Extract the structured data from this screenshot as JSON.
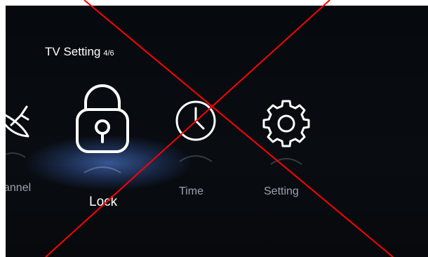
{
  "header": {
    "title": "TV Setting",
    "page_indicator": "4/6"
  },
  "menu": {
    "items": [
      {
        "label": "Channel",
        "visible_label": "annel",
        "icon": "satellite-dish-icon",
        "selected": false
      },
      {
        "label": "Lock",
        "visible_label": "Lock",
        "icon": "padlock-icon",
        "selected": true
      },
      {
        "label": "Time",
        "visible_label": "Time",
        "icon": "clock-icon",
        "selected": false
      },
      {
        "label": "Setting",
        "visible_label": "Setting",
        "icon": "gear-icon",
        "selected": false
      }
    ]
  },
  "overlay": {
    "mark": "red-x",
    "color": "#ff0000"
  },
  "colors": {
    "background": "#080b10",
    "highlight": "#4a6fbd",
    "text_active": "#ffffff",
    "text_inactive": "#9aa2ab"
  }
}
